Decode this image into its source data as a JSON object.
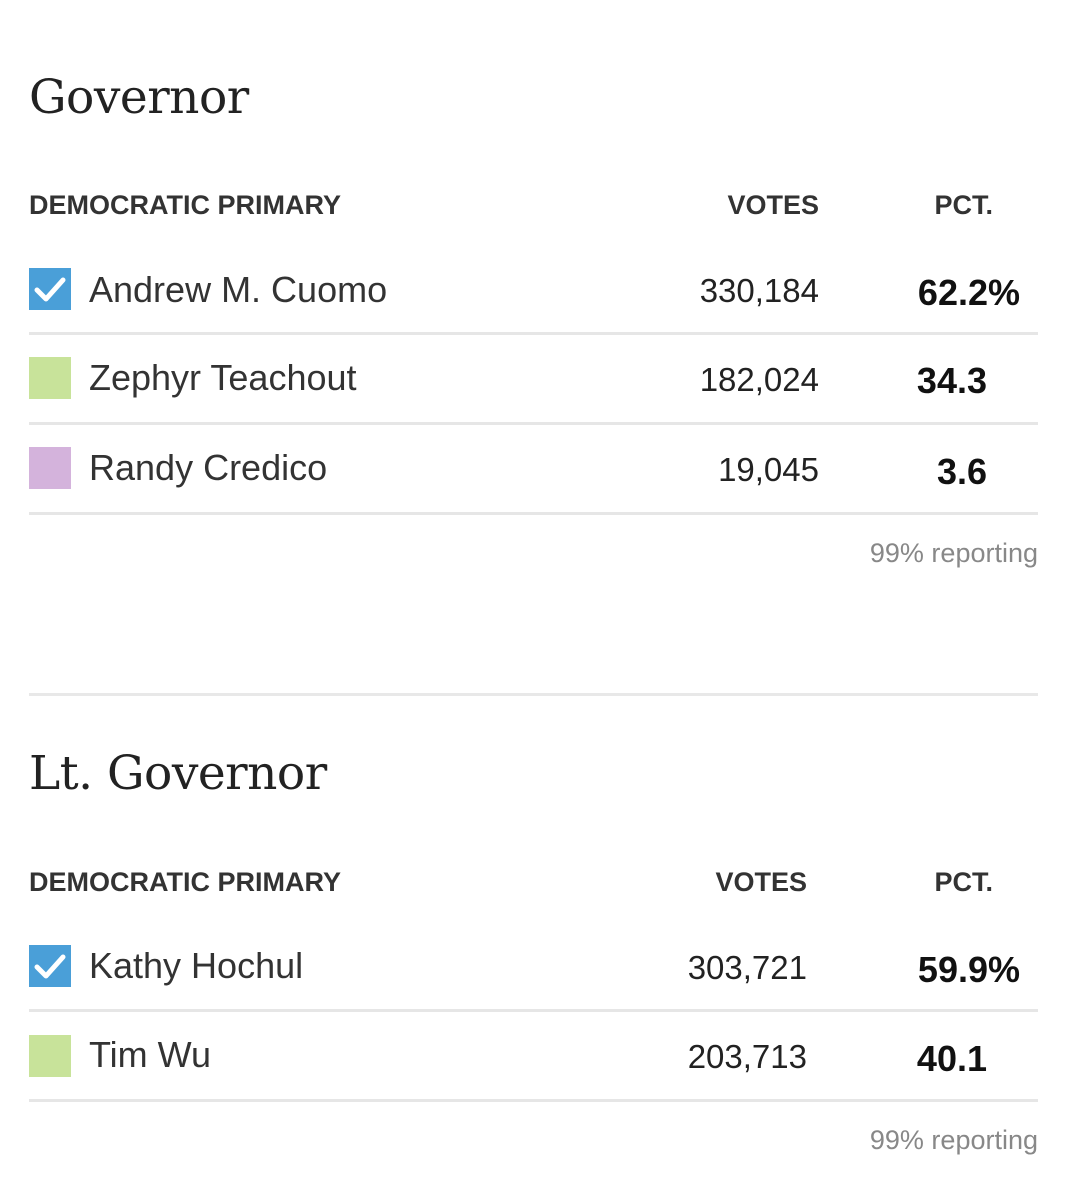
{
  "races": [
    {
      "title": "Governor",
      "primary_label": "DEMOCRATIC PRIMARY",
      "votes_label": "VOTES",
      "pct_label": "PCT.",
      "reporting": "99% reporting",
      "candidates": [
        {
          "name": "Andrew M. Cuomo",
          "votes": "330,184",
          "pct": "62.2%",
          "winner": true,
          "color": "#4a9fd8"
        },
        {
          "name": "Zephyr Teachout",
          "votes": "182,024",
          "pct": "34.3",
          "winner": false,
          "color": "#c8e39a"
        },
        {
          "name": "Randy Credico",
          "votes": "19,045",
          "pct": "3.6",
          "winner": false,
          "color": "#d4b3dc"
        }
      ]
    },
    {
      "title": "Lt. Governor",
      "primary_label": "DEMOCRATIC PRIMARY",
      "votes_label": "VOTES",
      "pct_label": "PCT.",
      "reporting": "99% reporting",
      "candidates": [
        {
          "name": "Kathy Hochul",
          "votes": "303,721",
          "pct": "59.9%",
          "winner": true,
          "color": "#4a9fd8"
        },
        {
          "name": "Tim Wu",
          "votes": "203,713",
          "pct": "40.1",
          "winner": false,
          "color": "#c8e39a"
        }
      ]
    }
  ]
}
